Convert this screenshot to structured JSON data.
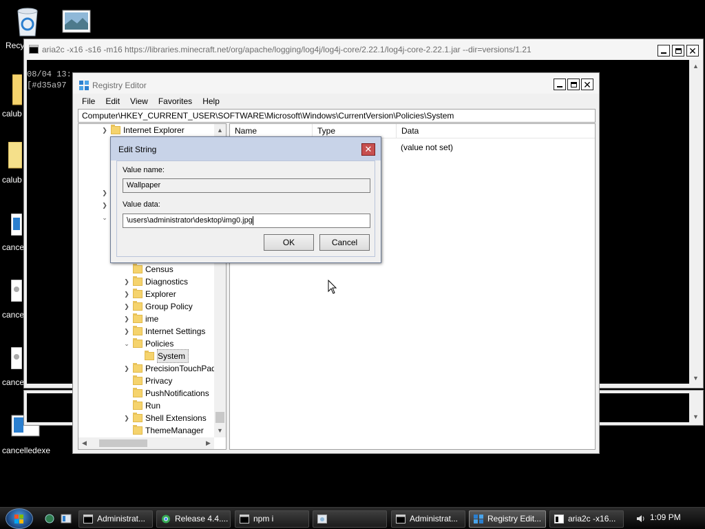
{
  "desktop": {
    "icons": [
      {
        "label": "Recy"
      },
      {
        "label": ""
      },
      {
        "label": "calub"
      },
      {
        "label": "calub"
      },
      {
        "label": "cance"
      },
      {
        "label": "cance"
      },
      {
        "label": "cance"
      },
      {
        "label": "cancelledexe"
      }
    ]
  },
  "console": {
    "title": "aria2c -x16 -s16 -m16 https://libraries.minecraft.net/org/apache/logging/log4j/log4j-core/2.22.1/log4j-core-2.22.1.jar --dir=versions/1.21",
    "lines": [
      "08/04 13:",
      "[#d35a97"
    ]
  },
  "regedit": {
    "title": "Registry Editor",
    "menu": [
      "File",
      "Edit",
      "View",
      "Favorites",
      "Help"
    ],
    "address": "Computer\\HKEY_CURRENT_USER\\SOFTWARE\\Microsoft\\Windows\\CurrentVersion\\Policies\\System",
    "tree": {
      "top_item": "Internet Explorer",
      "items": [
        "Census",
        "Diagnostics",
        "Explorer",
        "Group Policy",
        "ime",
        "Internet Settings",
        "Policies",
        "System",
        "PrecisionTouchPad",
        "Privacy",
        "PushNotifications",
        "Run",
        "Shell Extensions",
        "ThemeManager"
      ]
    },
    "columns": {
      "name": "Name",
      "type": "Type",
      "data": "Data"
    },
    "values": [
      {
        "data": "(value not set)"
      }
    ]
  },
  "dialog": {
    "title": "Edit String",
    "value_name_label": "Value name:",
    "value_name": "Wallpaper",
    "value_data_label": "Value data:",
    "value_data": "\\users\\administrator\\desktop\\img0.jpg",
    "ok": "OK",
    "cancel": "Cancel",
    "close": "✕"
  },
  "taskbar": {
    "buttons": [
      {
        "label": "Administrat...",
        "icon": "cmd-icon"
      },
      {
        "label": "Release 4.4....",
        "icon": "browser-icon"
      },
      {
        "label": "npm i",
        "icon": "cmd-icon"
      },
      {
        "label": "",
        "icon": "image-viewer-icon"
      },
      {
        "label": "Administrat...",
        "icon": "cmd-icon"
      },
      {
        "label": "Registry Edit...",
        "icon": "regedit-icon"
      },
      {
        "label": "aria2c -x16...",
        "icon": "cmd-icon"
      }
    ],
    "clock": "1:09 PM"
  },
  "colors": {
    "accent": "#1f4f8c",
    "dialog_title": "#c8d3e8",
    "close_red": "#c75050",
    "folder": "#f5d36d"
  }
}
